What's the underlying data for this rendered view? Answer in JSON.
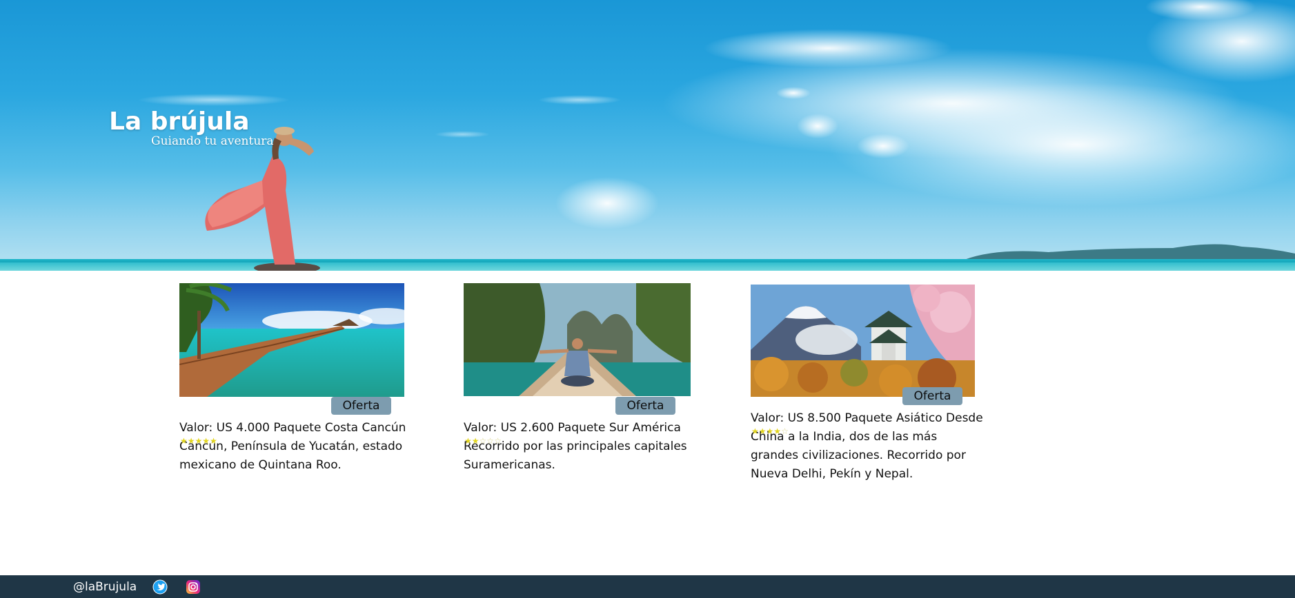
{
  "header": {
    "title": "La brújula",
    "subtitle": "Guiando tu aventura"
  },
  "packages": [
    {
      "price": "Valor: US 4.000 Paquete Costa Cancún",
      "description": "Cancún, Península de Yucatán, estado mexicano de Quintana Roo.",
      "offer_label": "Oferta",
      "rating": 5,
      "rating_max": 5
    },
    {
      "price": "Valor: US 2.600 Paquete Sur América",
      "description": "Recorrido por las principales capitales Suramericanas.",
      "offer_label": "Oferta",
      "rating": 2,
      "rating_max": 5
    },
    {
      "price": "Valor: US 8.500 Paquete Asiático",
      "description": "Desde China a la India, dos de las más grandes civilizaciones. Recorrido por Nueva Delhi, Pekín y Nepal.",
      "offer_label": "Oferta",
      "rating": 4,
      "rating_max": 5
    }
  ],
  "footer": {
    "handle": "@laBrujula",
    "social_icons": [
      "twitter-icon",
      "instagram-icon"
    ]
  },
  "colors": {
    "offer_button": "#7d9caf",
    "footer_bg": "#1f3646",
    "star": "#e2d51d"
  }
}
